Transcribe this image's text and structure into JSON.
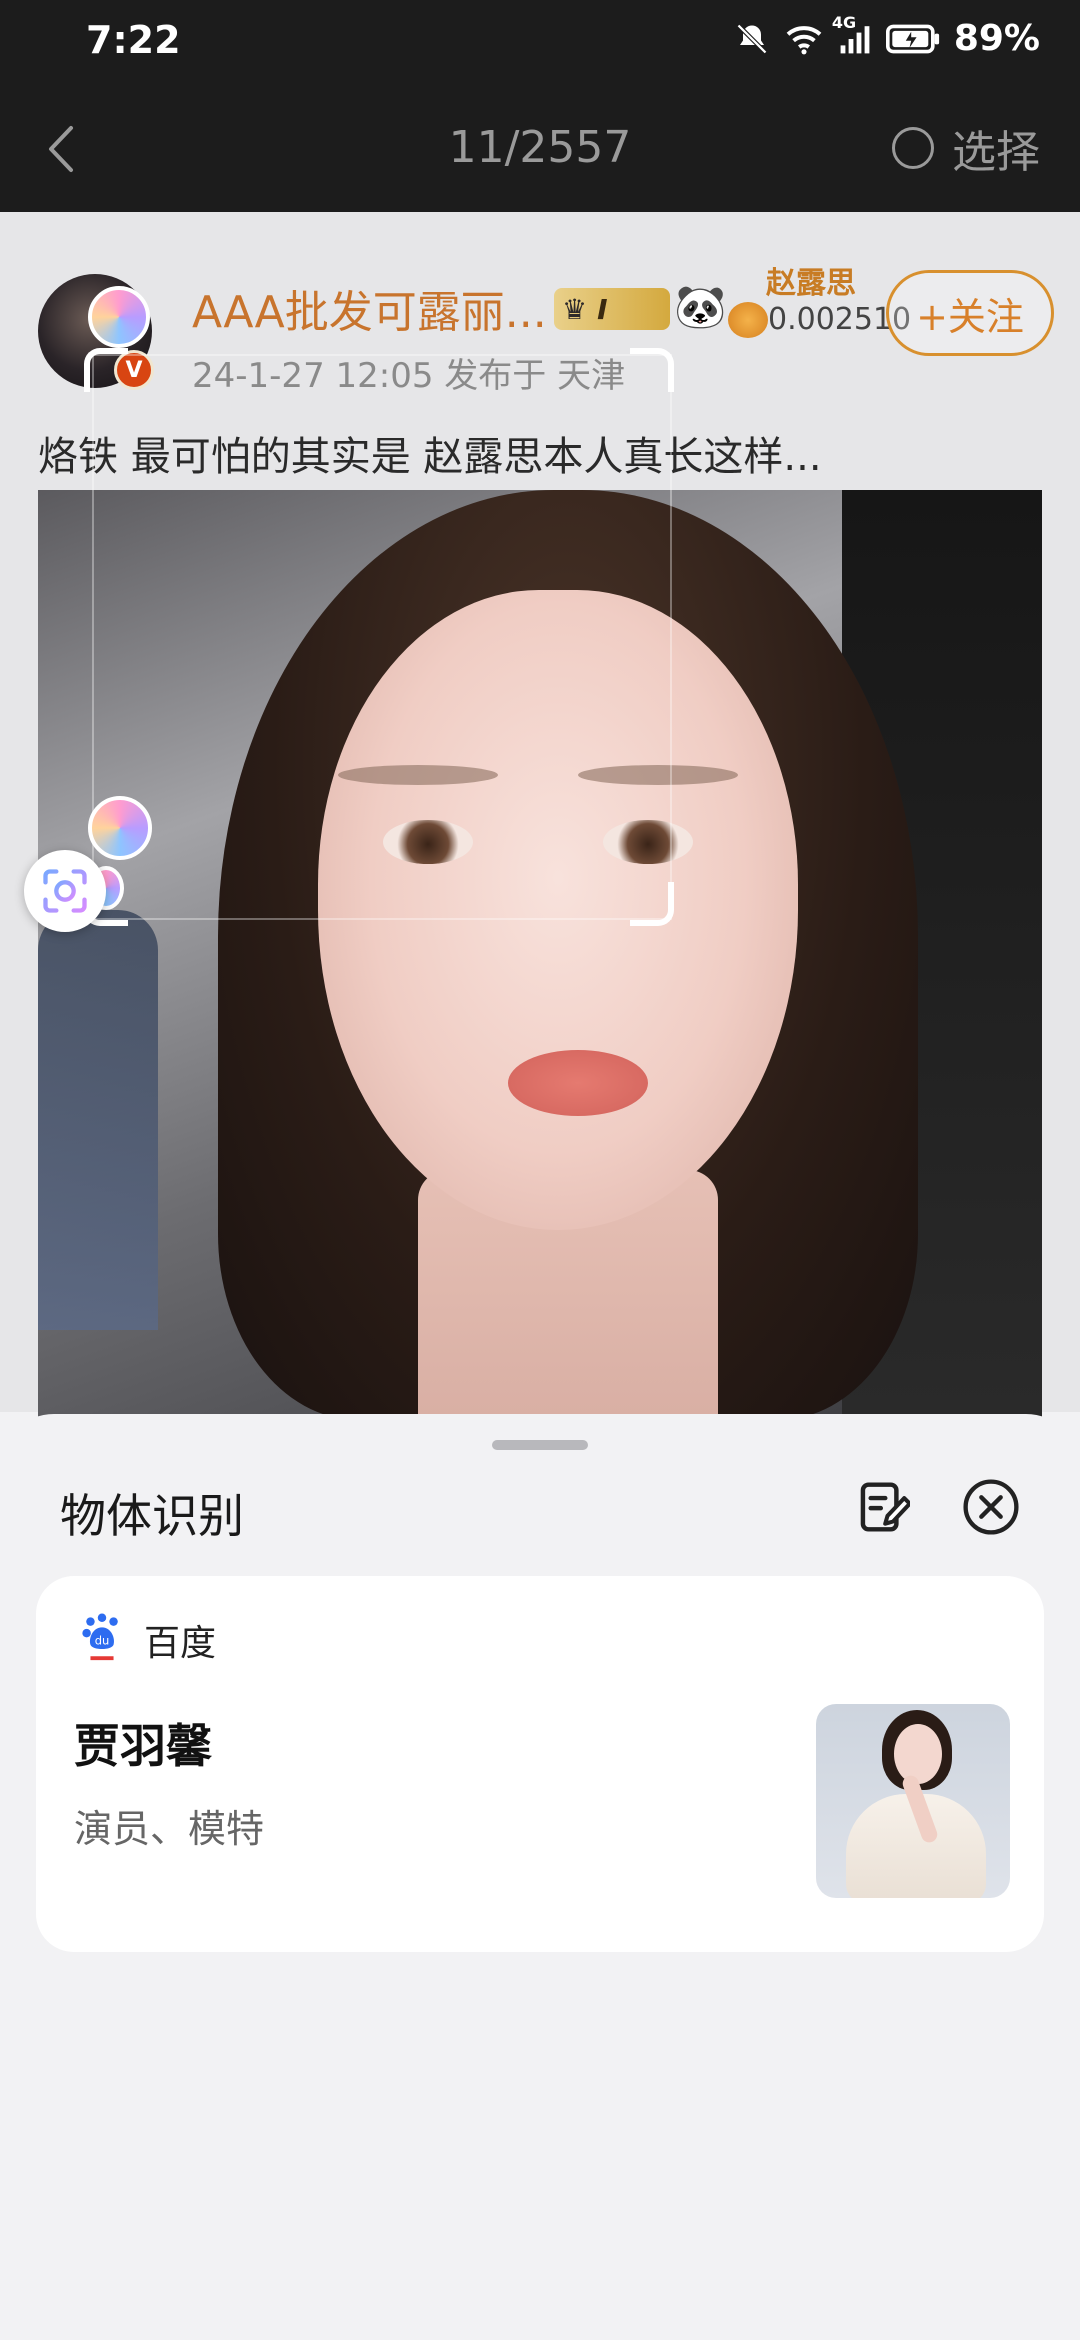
{
  "status_bar": {
    "time": "7:22",
    "network": "4G",
    "battery": "89%"
  },
  "nav": {
    "page_counter": "11/2557",
    "select_label": "选择"
  },
  "post": {
    "username": "AAA批发可露丽...",
    "badge_letter": "I",
    "fan_tag_name": "赵露思",
    "fan_tag_value": "0.002510",
    "follow_label": "+关注",
    "meta": "24-1-27 12:05  发布于 天津",
    "text": "烙铁 最可怕的其实是 赵露思本人真长这样..."
  },
  "sheet": {
    "title": "物体识别",
    "result": {
      "source": "百度",
      "name": "贾羽馨",
      "description": "演员、模特"
    }
  },
  "colors": {
    "nav_bg": "#1c1c1c",
    "accent_orange": "#d8802a",
    "username_color": "#c8742d",
    "sheet_bg": "#f2f2f4",
    "card_bg": "#ffffff"
  }
}
